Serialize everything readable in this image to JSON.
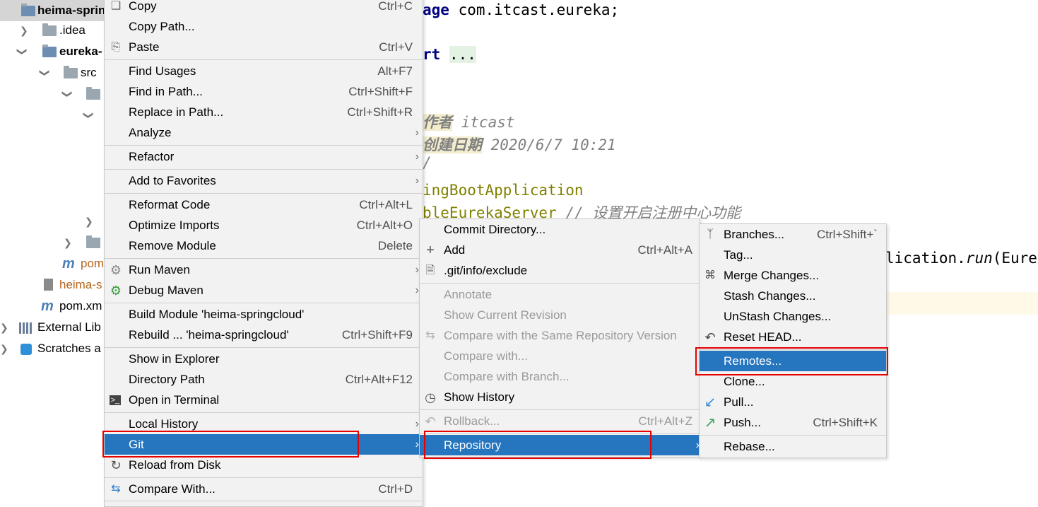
{
  "tree": {
    "root": "heima-sprin",
    "idea": ".idea",
    "module": "eureka-",
    "src": "src",
    "pom1": "pom",
    "iml": "heima-s",
    "pom2": "pom.xm",
    "ext": "External Lib",
    "scratches": "Scratches a"
  },
  "editor": {
    "l1a": "age",
    "l1b": " com.itcast.eureka;",
    "l2a": "rt",
    "l2b": "...",
    "l4a": "作者",
    "l4b": " itcast",
    "l5a": "创建日期",
    "l5b": " 2020/6/7 10:21",
    "l6": "/",
    "l7": "ingBootApplication",
    "l8a": "bleEurekaServer",
    "l8b": " // 设置开启注册中心功能",
    "l9a": "lication.",
    "l9b": "run",
    "l9c": "(Eure"
  },
  "menu1": [
    {
      "label": "Copy",
      "shortcut": "Ctrl+C"
    },
    {
      "label": "Copy Path...",
      "shortcut": ""
    },
    {
      "label": "Paste",
      "shortcut": "Ctrl+V"
    },
    {
      "label": "Find Usages",
      "shortcut": "Alt+F7"
    },
    {
      "label": "Find in Path...",
      "shortcut": "Ctrl+Shift+F"
    },
    {
      "label": "Replace in Path...",
      "shortcut": "Ctrl+Shift+R"
    },
    {
      "label": "Analyze",
      "shortcut": ""
    },
    {
      "label": "Refactor",
      "shortcut": ""
    },
    {
      "label": "Add to Favorites",
      "shortcut": ""
    },
    {
      "label": "Reformat Code",
      "shortcut": "Ctrl+Alt+L"
    },
    {
      "label": "Optimize Imports",
      "shortcut": "Ctrl+Alt+O"
    },
    {
      "label": "Remove Module",
      "shortcut": "Delete"
    },
    {
      "label": "Run Maven",
      "shortcut": ""
    },
    {
      "label": "Debug Maven",
      "shortcut": ""
    },
    {
      "label": "Build Module 'heima-springcloud'",
      "shortcut": ""
    },
    {
      "label": "Rebuild ... 'heima-springcloud'",
      "shortcut": "Ctrl+Shift+F9"
    },
    {
      "label": "Show in Explorer",
      "shortcut": ""
    },
    {
      "label": "Directory Path",
      "shortcut": "Ctrl+Alt+F12"
    },
    {
      "label": "Open in Terminal",
      "shortcut": ""
    },
    {
      "label": "Local History",
      "shortcut": ""
    },
    {
      "label": "Git",
      "shortcut": ""
    },
    {
      "label": "Reload from Disk",
      "shortcut": ""
    },
    {
      "label": "Compare With...",
      "shortcut": "Ctrl+D"
    }
  ],
  "menu2": [
    {
      "label": "Commit Directory...",
      "shortcut": ""
    },
    {
      "label": "Add",
      "shortcut": "Ctrl+Alt+A"
    },
    {
      "label": ".git/info/exclude",
      "shortcut": ""
    },
    {
      "label": "Annotate",
      "shortcut": ""
    },
    {
      "label": "Show Current Revision",
      "shortcut": ""
    },
    {
      "label": "Compare with the Same Repository Version",
      "shortcut": ""
    },
    {
      "label": "Compare with...",
      "shortcut": ""
    },
    {
      "label": "Compare with Branch...",
      "shortcut": ""
    },
    {
      "label": "Show History",
      "shortcut": ""
    },
    {
      "label": "Rollback...",
      "shortcut": "Ctrl+Alt+Z"
    },
    {
      "label": "Repository",
      "shortcut": ""
    }
  ],
  "menu3": [
    {
      "label": "Branches...",
      "shortcut": "Ctrl+Shift+`"
    },
    {
      "label": "Tag...",
      "shortcut": ""
    },
    {
      "label": "Merge Changes...",
      "shortcut": ""
    },
    {
      "label": "Stash Changes...",
      "shortcut": ""
    },
    {
      "label": "UnStash Changes...",
      "shortcut": ""
    },
    {
      "label": "Reset HEAD...",
      "shortcut": ""
    },
    {
      "label": "Remotes...",
      "shortcut": ""
    },
    {
      "label": "Clone...",
      "shortcut": ""
    },
    {
      "label": "Pull...",
      "shortcut": ""
    },
    {
      "label": "Push...",
      "shortcut": "Ctrl+Shift+K"
    },
    {
      "label": "Rebase...",
      "shortcut": ""
    }
  ],
  "glyphs": {
    "submenu": "›"
  },
  "colors": {
    "selection": "#2675bf",
    "highlight_box": "#e60000",
    "menu_bg": "#f2f2f2"
  }
}
